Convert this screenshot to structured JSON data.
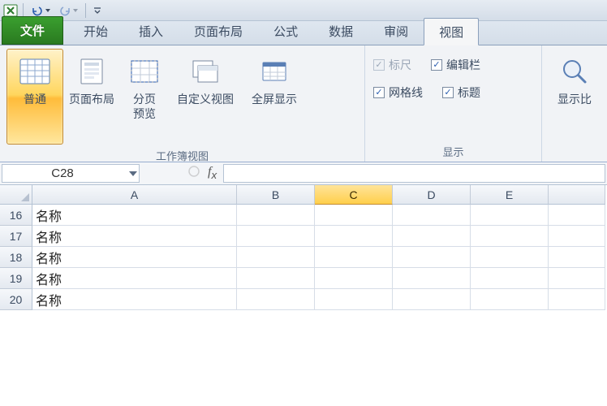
{
  "qat": {
    "undo_tip": "撤销",
    "redo_tip": "恢复"
  },
  "tabs": {
    "file": "文件",
    "home": "开始",
    "insert": "插入",
    "page_layout": "页面布局",
    "formulas": "公式",
    "data": "数据",
    "review": "审阅",
    "view": "视图"
  },
  "ribbon": {
    "workbook_views": {
      "label": "工作簿视图",
      "normal": "普通",
      "page_layout": "页面布局",
      "page_break": "分页\n预览",
      "custom_views": "自定义视图",
      "full_screen": "全屏显示"
    },
    "show": {
      "label": "显示",
      "ruler": "标尺",
      "formula_bar": "编辑栏",
      "gridlines": "网格线",
      "headings": "标题"
    },
    "zoom": {
      "ratio": "显示比"
    }
  },
  "name_box": "C28",
  "columns": [
    "A",
    "B",
    "C",
    "D",
    "E"
  ],
  "rows": [
    {
      "num": "16",
      "A": "名称"
    },
    {
      "num": "17",
      "A": "名称"
    },
    {
      "num": "18",
      "A": "名称"
    },
    {
      "num": "19",
      "A": "名称"
    },
    {
      "num": "20",
      "A": "名称"
    }
  ],
  "selected_col": "C"
}
